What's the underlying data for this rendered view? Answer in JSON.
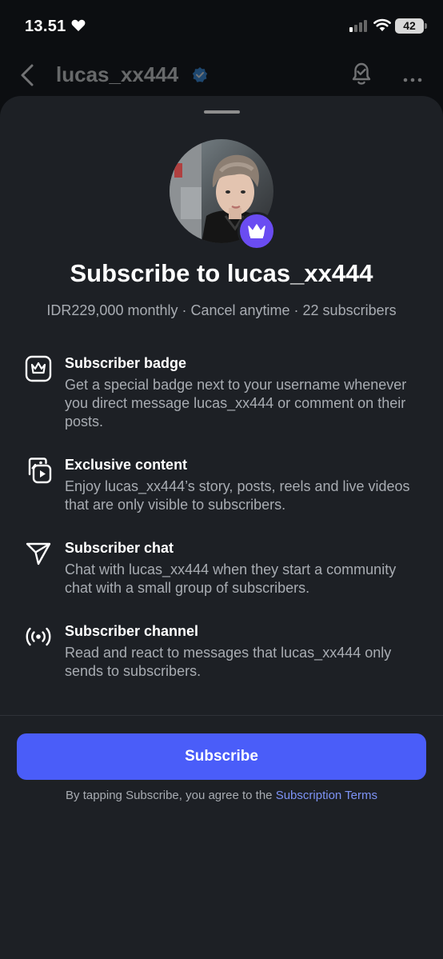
{
  "status_bar": {
    "time": "13.51",
    "battery": "42"
  },
  "header": {
    "username": "lucas_xx444"
  },
  "sheet": {
    "title": "Subscribe to lucas_xx444",
    "meta": "IDR229,000 monthly · Cancel anytime · 22 subscribers",
    "features": [
      {
        "icon": "crown-badge-icon",
        "title": "Subscriber badge",
        "description": "Get a special badge next to your username whenever you direct message lucas_xx444 or comment on their posts."
      },
      {
        "icon": "media-play-icon",
        "title": "Exclusive content",
        "description": "Enjoy lucas_xx444’s story, posts, reels and live videos that are only visible to subscribers."
      },
      {
        "icon": "send-icon",
        "title": "Subscriber chat",
        "description": "Chat with lucas_xx444 when they start a community chat with a small group of subscribers."
      },
      {
        "icon": "broadcast-icon",
        "title": "Subscriber channel",
        "description": "Read and react to messages that lucas_xx444 only sends to subscribers."
      }
    ],
    "subscribe_label": "Subscribe",
    "terms_prefix": "By tapping Subscribe, you agree to the",
    "terms_link": "Subscription Terms"
  },
  "colors": {
    "accent": "#4a5df9",
    "badge": "#6a4cf2",
    "link": "#7d93f6",
    "sheet_bg": "#1d2025"
  }
}
